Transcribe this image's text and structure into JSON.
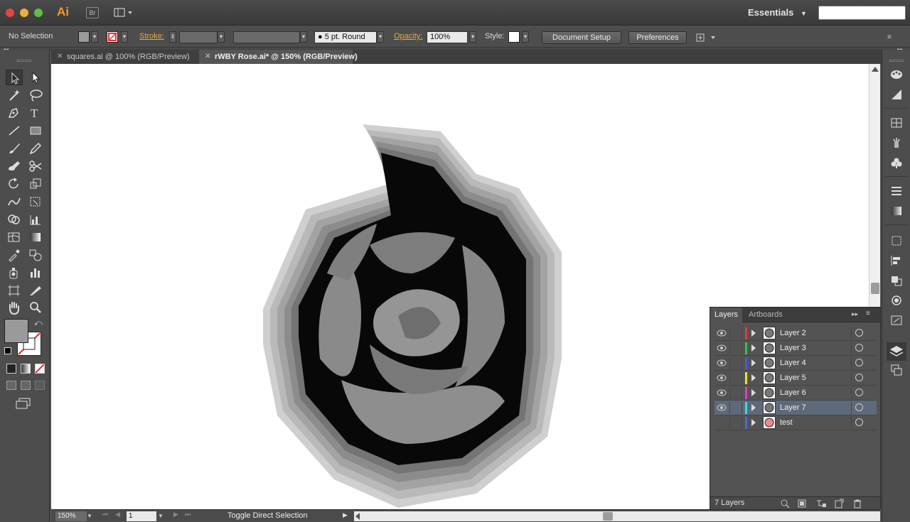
{
  "app": {
    "logo": "Ai",
    "bridge_label": "Br",
    "workspace": "Essentials",
    "search_placeholder": ""
  },
  "controlbar": {
    "selection_status": "No Selection",
    "stroke_label": "Stroke:",
    "brush_label": "5 pt. Round",
    "opacity_label": "Opacity:",
    "opacity_value": "100%",
    "style_label": "Style:",
    "document_setup": "Document Setup",
    "preferences": "Preferences"
  },
  "tabs": [
    {
      "label": "squares.ai @ 100% (RGB/Preview)"
    },
    {
      "label": "rWBY Rose.ai* @ 150% (RGB/Preview)"
    }
  ],
  "status": {
    "zoom": "150%",
    "artboard": "1",
    "tool_hint": "Toggle Direct Selection"
  },
  "layers_panel": {
    "tab_layers": "Layers",
    "tab_artboards": "Artboards",
    "count": "7 Layers",
    "layers": [
      {
        "name": "Layer 2",
        "color": "#e0403a",
        "visible": true,
        "selected": false
      },
      {
        "name": "Layer 3",
        "color": "#35c24a",
        "visible": true,
        "selected": false
      },
      {
        "name": "Layer 4",
        "color": "#4a5ae0",
        "visible": true,
        "selected": false
      },
      {
        "name": "Layer 5",
        "color": "#e8e03a",
        "visible": true,
        "selected": false
      },
      {
        "name": "Layer 6",
        "color": "#e040c8",
        "visible": true,
        "selected": false
      },
      {
        "name": "Layer 7",
        "color": "#3ad8e0",
        "visible": true,
        "selected": true
      },
      {
        "name": "test",
        "color": "#4a6ae0",
        "visible": false,
        "selected": false
      }
    ]
  },
  "colors": {
    "fill_swatch": "#9a9a9a",
    "ui_accent": "#f0a33b"
  },
  "icons": [
    "selection-tool-icon",
    "direct-selection-tool-icon",
    "magic-wand-icon",
    "lasso-icon",
    "pen-tool-icon",
    "type-tool-icon",
    "line-tool-icon",
    "rectangle-tool-icon",
    "paintbrush-icon",
    "pencil-icon",
    "blob-brush-icon",
    "scissors-icon",
    "rotate-icon",
    "scale-icon",
    "warp-icon",
    "free-transform-icon",
    "shape-builder-icon",
    "graph-icon",
    "mesh-icon",
    "gradient-icon",
    "eyedropper-icon",
    "blend-icon",
    "symbol-sprayer-icon",
    "column-graph-icon",
    "artboard-tool-icon",
    "slice-icon",
    "hand-icon",
    "zoom-icon"
  ]
}
